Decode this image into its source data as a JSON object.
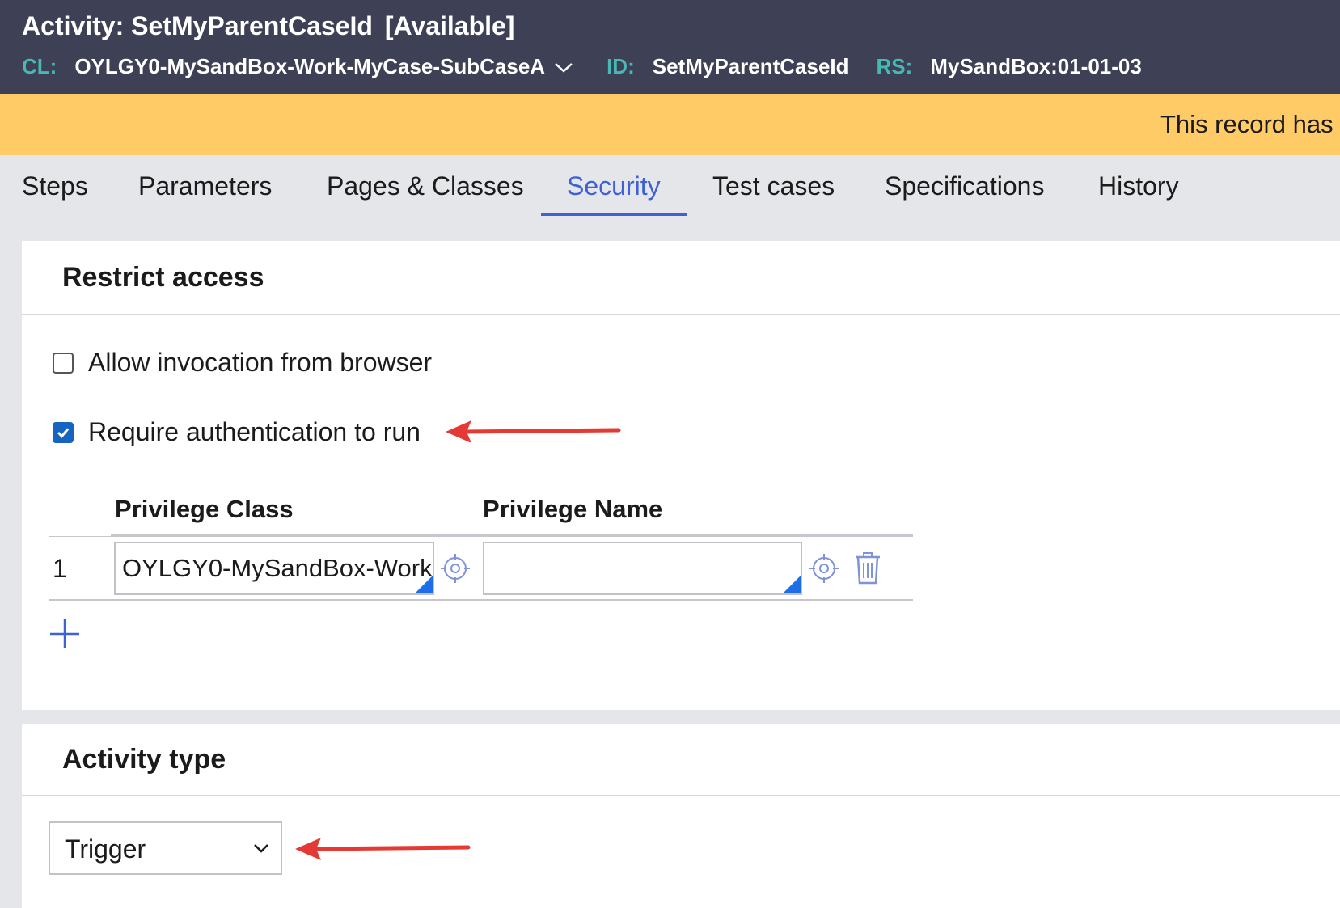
{
  "header": {
    "title_prefix": "Activity:",
    "title_name": "SetMyParentCaseId",
    "title_status": "[Available]",
    "cl_label": "CL:",
    "cl_value": "OYLGY0-MySandBox-Work-MyCase-SubCaseA",
    "id_label": "ID:",
    "id_value": "SetMyParentCaseId",
    "rs_label": "RS:",
    "rs_value": "MySandBox:01-01-03"
  },
  "banner": {
    "text": "This record has"
  },
  "tabs": [
    {
      "label": "Steps",
      "active": false
    },
    {
      "label": "Parameters",
      "active": false
    },
    {
      "label": "Pages & Classes",
      "active": false
    },
    {
      "label": "Security",
      "active": true
    },
    {
      "label": "Test cases",
      "active": false
    },
    {
      "label": "Specifications",
      "active": false
    },
    {
      "label": "History",
      "active": false
    }
  ],
  "restrict_access": {
    "title": "Restrict access",
    "allow_browser_label": "Allow invocation from browser",
    "allow_browser_checked": false,
    "require_auth_label": "Require authentication to run",
    "require_auth_checked": true,
    "table": {
      "headers": {
        "privilege_class": "Privilege Class",
        "privilege_name": "Privilege Name"
      },
      "rows": [
        {
          "num": "1",
          "privilege_class": "OYLGY0-MySandBox-Work",
          "privilege_name": ""
        }
      ]
    }
  },
  "activity_type": {
    "title": "Activity type",
    "selected": "Trigger"
  },
  "icons": {
    "chevron": "chevron-down-icon",
    "target": "target-icon",
    "trash": "trash-icon",
    "add": "plus-icon",
    "arrow": "red-arrow-annotation"
  },
  "colors": {
    "header_bg": "#3e4155",
    "header_label": "#47b8b4",
    "banner_bg": "#fecb66",
    "accent": "#3f61d4",
    "annotation_red": "#e53935"
  }
}
